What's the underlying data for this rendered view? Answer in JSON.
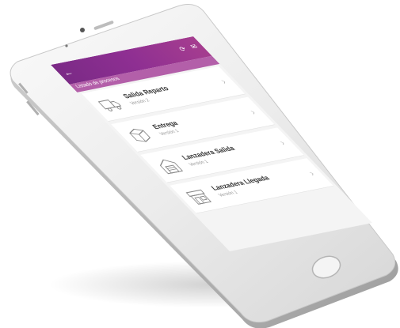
{
  "header": {
    "back_icon": "arrow-left-icon",
    "title": "",
    "subtitle": "Listado de procesos",
    "icons": [
      "refresh-icon",
      "mail-icon"
    ],
    "accent_color": "#8e2f92"
  },
  "items": [
    {
      "title": "Salida Reparto",
      "version": "Versión 2",
      "icon": "truck-icon"
    },
    {
      "title": "Entrega",
      "version": "Versión 1",
      "icon": "box-icon"
    },
    {
      "title": "Lanzadera Salida",
      "version": "Versión 1",
      "icon": "warehouse-icon"
    },
    {
      "title": "Lanzadera Llegada",
      "version": "Versión 1",
      "icon": "store-icon"
    }
  ]
}
